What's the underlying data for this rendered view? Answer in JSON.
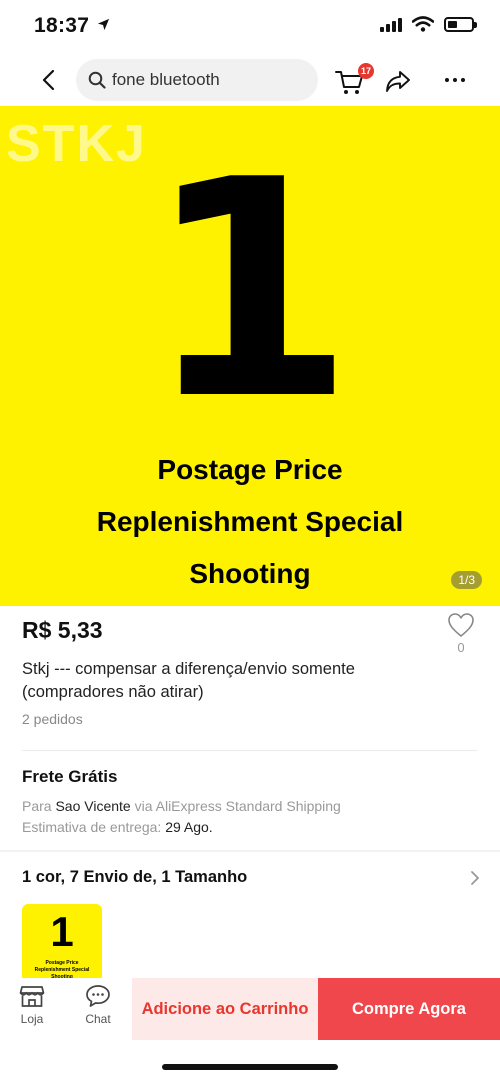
{
  "status_bar": {
    "time": "18:37"
  },
  "header": {
    "search_text": "fone bluetooth",
    "cart_badge": "17"
  },
  "product_image": {
    "watermark": "STKJ",
    "big_number": "1",
    "caption_lines": [
      "Postage Price",
      "Replenishment Special",
      "Shooting"
    ],
    "counter": "1/3",
    "background_color": "#fff200"
  },
  "product": {
    "price": "R$ 5,33",
    "wishlist_count": "0",
    "title": "Stkj --- compensar a diferença/envio somente (compradores não atirar)",
    "orders": "2 pedidos"
  },
  "shipping": {
    "title": "Frete Grátis",
    "to_prefix": "Para",
    "destination": "Sao Vicente",
    "via_text": "via AliExpress Standard Shipping",
    "estimate_label": "Estimativa de entrega:",
    "estimate_date": "29 Ago."
  },
  "variants": {
    "summary": "1 cor, 7 Envio de, 1 Tamanho"
  },
  "thumbnail": {
    "number": "1",
    "caption_lines": [
      "Postage Price",
      "Replenishment Special",
      "Shooting"
    ]
  },
  "bottom_bar": {
    "store_label": "Loja",
    "chat_label": "Chat",
    "add_to_cart": "Adicione ao Carrinho",
    "buy_now": "Compre Agora"
  },
  "colors": {
    "accent_red": "#e8372e",
    "buy_now_bg": "#f0474c",
    "add_cart_bg": "#fde9e8",
    "product_yellow": "#fff200"
  },
  "icons": [
    "location-arrow-icon",
    "signal-icon",
    "wifi-icon",
    "battery-icon",
    "back-icon",
    "search-icon",
    "cart-icon",
    "share-icon",
    "more-icon",
    "heart-icon",
    "chevron-right-icon",
    "store-icon",
    "chat-icon"
  ]
}
